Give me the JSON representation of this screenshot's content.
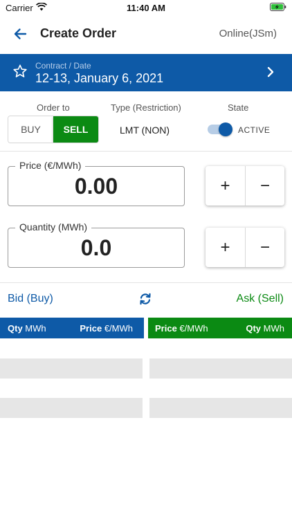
{
  "status_bar": {
    "carrier": "Carrier",
    "time": "11:40 AM"
  },
  "header": {
    "title": "Create Order",
    "status": "Online(JSm)"
  },
  "contract": {
    "label": "Contract / Date",
    "value": "12-13, January 6, 2021"
  },
  "order": {
    "order_to_label": "Order to",
    "buy_label": "BUY",
    "sell_label": "SELL",
    "selected_side": "SELL",
    "type_label": "Type (Restriction)",
    "type_value": "LMT (NON)",
    "state_label": "State",
    "state_value": "ACTIVE",
    "state_on": true
  },
  "price": {
    "label": "Price (€/MWh)",
    "value": "0.00",
    "plus": "+",
    "minus": "−"
  },
  "quantity": {
    "label": "Quantity (MWh)",
    "value": "0.0",
    "plus": "+",
    "minus": "−"
  },
  "orderbook": {
    "bid_label": "Bid (Buy)",
    "ask_label": "Ask (Sell)",
    "bid_columns": {
      "qty_bold": "Qty",
      "qty_unit": "MWh",
      "price_bold": "Price",
      "price_unit": "€/MWh"
    },
    "ask_columns": {
      "price_bold": "Price",
      "price_unit": "€/MWh",
      "qty_bold": "Qty",
      "qty_unit": "MWh"
    }
  },
  "colors": {
    "primary_blue": "#0e5aa7",
    "sell_green": "#0b8a13",
    "row_gray": "#e6e6e6"
  }
}
